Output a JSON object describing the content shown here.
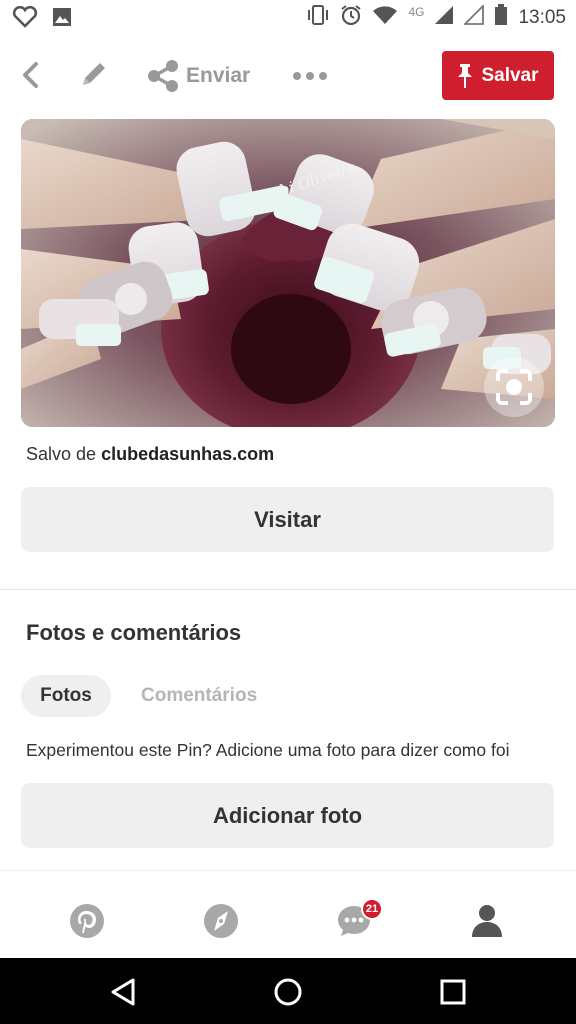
{
  "status_bar": {
    "network": "4G",
    "time": "13:05",
    "icons": [
      "heart-outline-icon",
      "image-icon",
      "vibrate-icon",
      "alarm-icon",
      "wifi-icon",
      "signal-icon",
      "signal-empty-icon",
      "battery-icon"
    ]
  },
  "toolbar": {
    "back_icon": "chevron-left-icon",
    "edit_icon": "pencil-icon",
    "share_label": "Enviar",
    "more_icon": "ellipsis-icon",
    "save_label": "Salvar",
    "save_color": "#cf1e2e"
  },
  "pin": {
    "watermark": "Fabi Oliveira",
    "lens_icon": "visual-search-icon"
  },
  "source": {
    "prefix": "Salvo de ",
    "domain": "clubedasunhas.com"
  },
  "visit_label": "Visitar",
  "photos_section": {
    "title": "Fotos e comentários",
    "tabs": [
      {
        "label": "Fotos",
        "active": true
      },
      {
        "label": "Comentários",
        "active": false
      }
    ],
    "prompt": "Experimentou este Pin? Adicione uma foto para dizer como foi",
    "add_photo_label": "Adicionar foto"
  },
  "bottom_nav": {
    "items": [
      "pinterest-home-icon",
      "compass-explore-icon",
      "chat-icon",
      "profile-icon"
    ],
    "notification_count": "21"
  },
  "android_nav": [
    "back-triangle-icon",
    "home-circle-icon",
    "recents-square-icon"
  ]
}
